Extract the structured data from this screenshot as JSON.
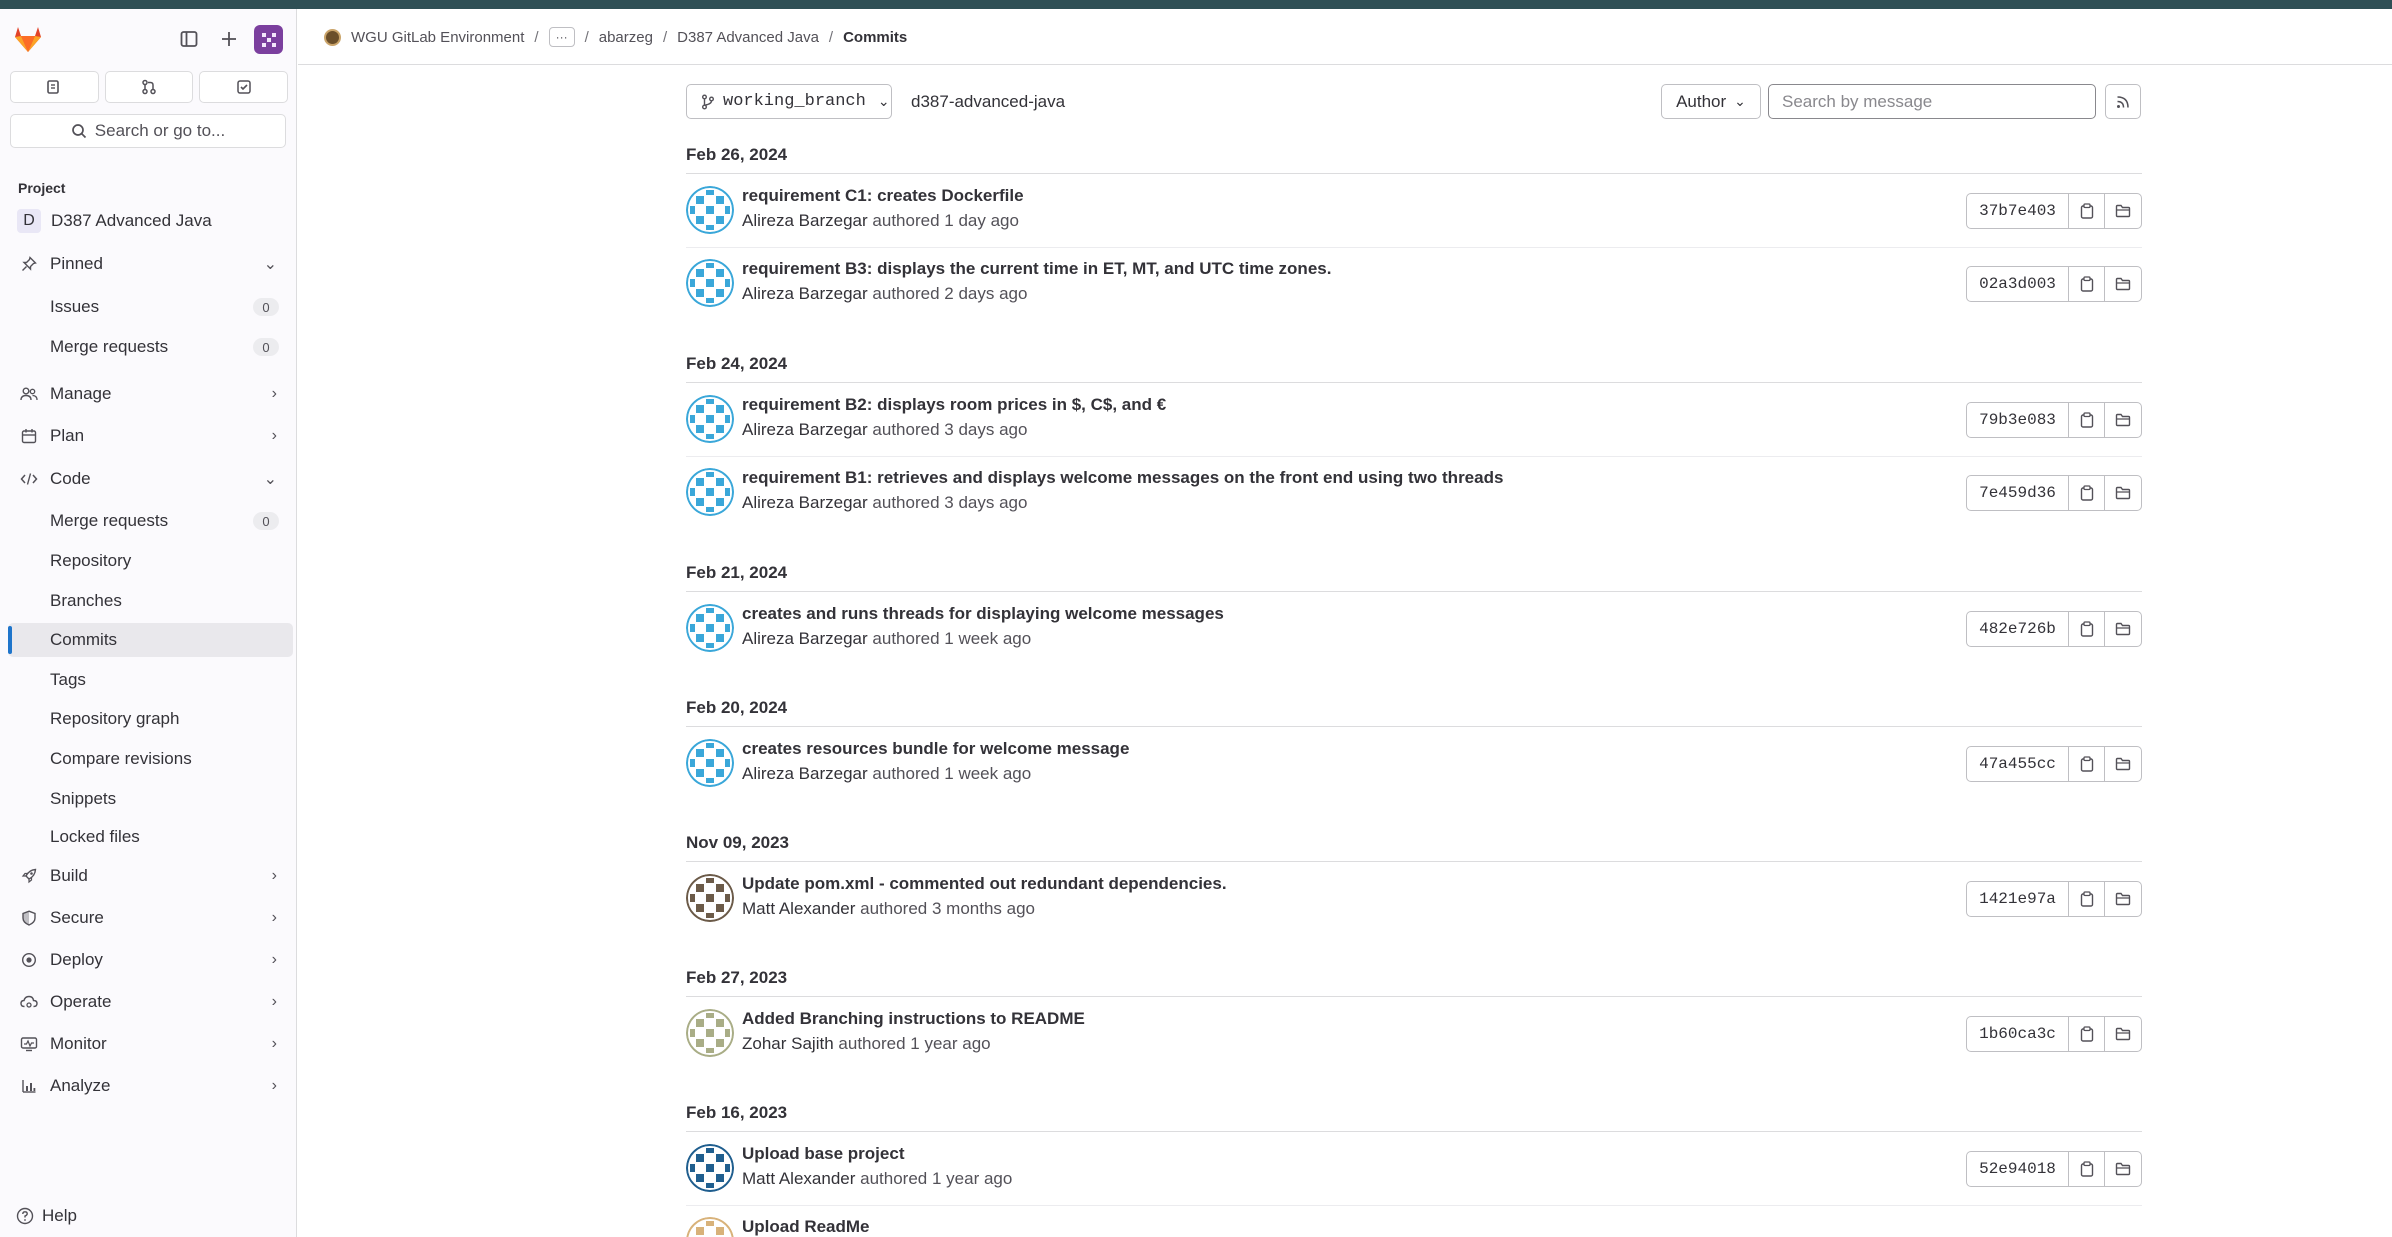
{
  "sidebar": {
    "search_label": "Search or go to...",
    "section_label": "Project",
    "project_initial": "D",
    "project_name": "D387 Advanced Java",
    "pinned": {
      "label": "Pinned"
    },
    "pinned_items": [
      {
        "label": "Issues",
        "count": "0"
      },
      {
        "label": "Merge requests",
        "count": "0"
      }
    ],
    "manage": "Manage",
    "plan": "Plan",
    "code": "Code",
    "code_items": [
      {
        "label": "Merge requests",
        "count": "0"
      },
      {
        "label": "Repository"
      },
      {
        "label": "Branches"
      },
      {
        "label": "Commits"
      },
      {
        "label": "Tags"
      },
      {
        "label": "Repository graph"
      },
      {
        "label": "Compare revisions"
      },
      {
        "label": "Snippets"
      },
      {
        "label": "Locked files"
      }
    ],
    "build": "Build",
    "secure": "Secure",
    "deploy": "Deploy",
    "operate": "Operate",
    "monitor": "Monitor",
    "analyze": "Analyze",
    "help": "Help"
  },
  "breadcrumb": {
    "org": "WGU GitLab Environment",
    "more": "···",
    "user": "abarzeg",
    "project": "D387 Advanced Java",
    "current": "Commits"
  },
  "toolbar": {
    "branch": "working_branch",
    "repo_path": "d387-advanced-java",
    "author_label": "Author",
    "search_placeholder": "Search by message"
  },
  "groups": [
    {
      "date": "Feb 26, 2024",
      "commits": [
        {
          "title": "requirement C1: creates Dockerfile",
          "author": "Alireza Barzegar",
          "verb": "authored",
          "time": "1 day ago",
          "sha": "37b7e403"
        },
        {
          "title": "requirement B3: displays the current time in ET, MT, and UTC time zones.",
          "author": "Alireza Barzegar",
          "verb": "authored",
          "time": "2 days ago",
          "sha": "02a3d003"
        }
      ]
    },
    {
      "date": "Feb 24, 2024",
      "commits": [
        {
          "title": "requirement B2: displays room prices in $, C$, and €",
          "author": "Alireza Barzegar",
          "verb": "authored",
          "time": "3 days ago",
          "sha": "79b3e083"
        },
        {
          "title": "requirement B1: retrieves and displays welcome messages on the front end using two threads",
          "author": "Alireza Barzegar",
          "verb": "authored",
          "time": "3 days ago",
          "sha": "7e459d36"
        }
      ]
    },
    {
      "date": "Feb 21, 2024",
      "commits": [
        {
          "title": "creates and runs threads for displaying welcome messages",
          "author": "Alireza Barzegar",
          "verb": "authored",
          "time": "1 week ago",
          "sha": "482e726b"
        }
      ]
    },
    {
      "date": "Feb 20, 2024",
      "commits": [
        {
          "title": "creates resources bundle for welcome message",
          "author": "Alireza Barzegar",
          "verb": "authored",
          "time": "1 week ago",
          "sha": "47a455cc"
        }
      ]
    },
    {
      "date": "Nov 09, 2023",
      "commits": [
        {
          "title": "Update pom.xml - commented out redundant dependencies.",
          "author": "Matt Alexander",
          "verb": "authored",
          "time": "3 months ago",
          "sha": "1421e97a"
        }
      ]
    },
    {
      "date": "Feb 27, 2023",
      "commits": [
        {
          "title": "Added Branching instructions to README",
          "author": "Zohar Sajith",
          "verb": "authored",
          "time": "1 year ago",
          "sha": "1b60ca3c"
        }
      ]
    },
    {
      "date": "Feb 16, 2023",
      "commits": [
        {
          "title": "Upload base project",
          "author": "Matt Alexander",
          "verb": "authored",
          "time": "1 year ago",
          "sha": "52e94018"
        },
        {
          "title": "Upload ReadMe",
          "author": "",
          "verb": "",
          "time": "",
          "sha": ""
        }
      ]
    }
  ],
  "colors": {
    "accent": "#1f75cb",
    "avatar_alireza": "#3aa7d9",
    "avatar_matt_1": "#6b5a48",
    "avatar_zohar": "#a9ad86",
    "avatar_matt_2": "#1f5e8e",
    "avatar_readme": "#d8b27a"
  }
}
